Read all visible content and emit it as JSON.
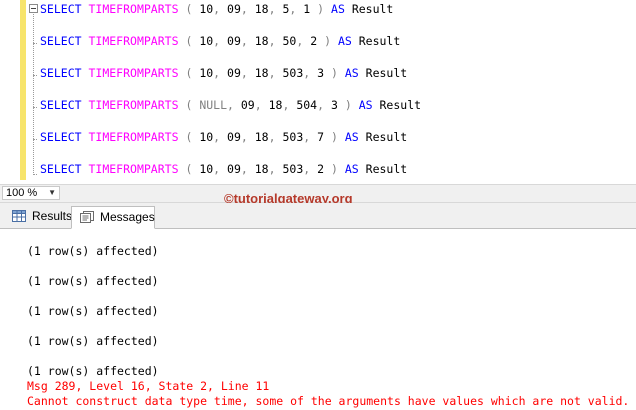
{
  "editor": {
    "lines": [
      {
        "kw1": "SELECT",
        "fn": "TIMEFROMPARTS",
        "open": "(",
        "a1": "10",
        "a2": "09",
        "a3": "18",
        "a4": "5",
        "a5": "1",
        "close": ")",
        "kw2": "AS",
        "alias": "Result"
      },
      {
        "kw1": "SELECT",
        "fn": "TIMEFROMPARTS",
        "open": "(",
        "a1": "10",
        "a2": "09",
        "a3": "18",
        "a4": "50",
        "a5": "2",
        "close": ")",
        "kw2": "AS",
        "alias": "Result"
      },
      {
        "kw1": "SELECT",
        "fn": "TIMEFROMPARTS",
        "open": "(",
        "a1": "10",
        "a2": "09",
        "a3": "18",
        "a4": "503",
        "a5": "3",
        "close": ")",
        "kw2": "AS",
        "alias": "Result"
      },
      {
        "kw1": "SELECT",
        "fn": "TIMEFROMPARTS",
        "open": "(",
        "a1": "NULL",
        "a2": "09",
        "a3": "18",
        "a4": "504",
        "a5": "3",
        "close": ")",
        "kw2": "AS",
        "alias": "Result"
      },
      {
        "kw1": "SELECT",
        "fn": "TIMEFROMPARTS",
        "open": "(",
        "a1": "10",
        "a2": "09",
        "a3": "18",
        "a4": "503",
        "a5": "7",
        "close": ")",
        "kw2": "AS",
        "alias": "Result"
      },
      {
        "kw1": "SELECT",
        "fn": "TIMEFROMPARTS",
        "open": "(",
        "a1": "10",
        "a2": "09",
        "a3": "18",
        "a4": "503",
        "a5": "2",
        "close": ")",
        "kw2": "AS",
        "alias": "Result"
      }
    ],
    "colors": {
      "keyword": "#0000ff",
      "function": "#ff00ff",
      "number": "#000000",
      "null": "#808080",
      "punctuation": "#808080",
      "change_bar": "#f7e46b"
    }
  },
  "zoom": {
    "value": "100 %",
    "arrow_icon": "chevron-down-icon"
  },
  "tabs": [
    {
      "label": "Results",
      "icon": "grid-icon"
    },
    {
      "label": "Messages",
      "icon": "messages-icon",
      "active": true
    }
  ],
  "watermark": "©tutorialgateway.org",
  "messages": {
    "rows_affected": [
      "(1 row(s) affected)",
      "(1 row(s) affected)",
      "(1 row(s) affected)",
      "(1 row(s) affected)",
      "(1 row(s) affected)"
    ],
    "error_header": "Msg 289, Level 16, State 2, Line 11",
    "error_text": "Cannot construct data type time, some of the arguments have values which are not valid.",
    "error_color": "#ff0000"
  }
}
